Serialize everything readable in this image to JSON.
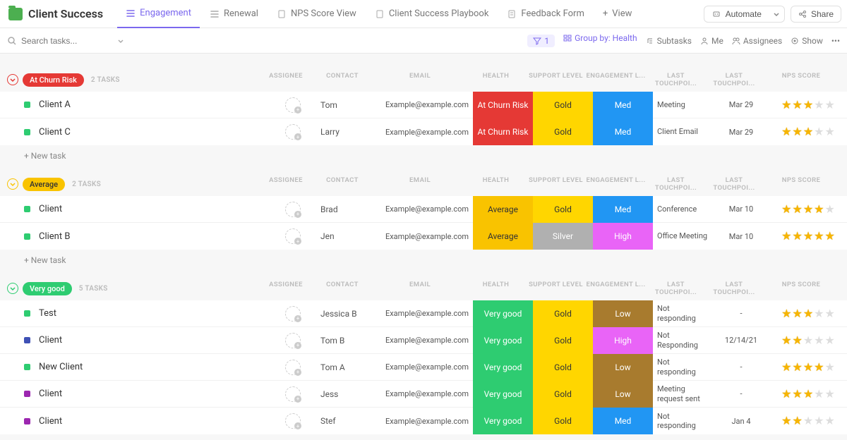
{
  "header": {
    "title": "Client Success",
    "tabs": [
      {
        "label": "Engagement",
        "icon": "list"
      },
      {
        "label": "Renewal",
        "icon": "list"
      },
      {
        "label": "NPS Score View",
        "icon": "doc"
      },
      {
        "label": "Client Success Playbook",
        "icon": "doc"
      },
      {
        "label": "Feedback Form",
        "icon": "form"
      }
    ],
    "add_view": "View",
    "automate": "Automate",
    "share": "Share"
  },
  "toolbar": {
    "search_placeholder": "Search tasks...",
    "filter_count": "1",
    "group_by": "Group by: Health",
    "subtasks": "Subtasks",
    "me": "Me",
    "assignees": "Assignees",
    "show": "Show"
  },
  "columns": {
    "assignee": "ASSIGNEE",
    "contact": "CONTACT",
    "email": "EMAIL",
    "health": "HEALTH",
    "support": "SUPPORT LEVEL",
    "engagement": "ENGAGEMENT L...",
    "touch_note": "LAST TOUCHPOI...",
    "touch_date": "LAST TOUCHPOI...",
    "nps": "NPS SCORE"
  },
  "new_task_label": "+ New task",
  "groups": [
    {
      "name": "At Churn Risk",
      "color": "red",
      "count": "2 TASKS",
      "rows": [
        {
          "dot": "#2ecc71",
          "name": "Client A",
          "contact": "Tom",
          "email": "Example@example.com",
          "health": "At Churn Risk",
          "health_c": "red",
          "support": "Gold",
          "support_c": "gold",
          "engage": "Med",
          "engage_c": "blue",
          "touch_note": "Meeting",
          "touch_date": "Mar 29",
          "nps": 3
        },
        {
          "dot": "#2ecc71",
          "name": "Client C",
          "contact": "Larry",
          "email": "Example@example.com",
          "health": "At Churn Risk",
          "health_c": "red",
          "support": "Gold",
          "support_c": "gold",
          "engage": "Med",
          "engage_c": "blue",
          "touch_note": "Client Email",
          "touch_date": "Mar 29",
          "nps": 3
        }
      ]
    },
    {
      "name": "Average",
      "color": "yellow",
      "count": "2 TASKS",
      "rows": [
        {
          "dot": "#2ecc71",
          "name": "Client",
          "contact": "Brad",
          "email": "Example@example.com",
          "health": "Average",
          "health_c": "yellow",
          "support": "Gold",
          "support_c": "gold",
          "engage": "Med",
          "engage_c": "blue",
          "touch_note": "Conference",
          "touch_date": "Mar 10",
          "nps": 4
        },
        {
          "dot": "#2ecc71",
          "name": "Client B",
          "contact": "Jen",
          "email": "Example@example.com",
          "health": "Average",
          "health_c": "yellow",
          "support": "Silver",
          "support_c": "silver",
          "engage": "High",
          "engage_c": "pink",
          "touch_note": "Office Meeting",
          "touch_date": "Mar 10",
          "nps": 5
        }
      ]
    },
    {
      "name": "Very good",
      "color": "green",
      "count": "5 TASKS",
      "rows": [
        {
          "dot": "#2ecc71",
          "name": "Test",
          "contact": "Jessica B",
          "email": "Example@example.com",
          "health": "Very good",
          "health_c": "green",
          "support": "Gold",
          "support_c": "gold",
          "engage": "Low",
          "engage_c": "brown",
          "touch_note": "Not responding",
          "touch_date": "-",
          "nps": 3
        },
        {
          "dot": "#3f51b5",
          "name": "Client",
          "contact": "Tom B",
          "email": "Example@example.com",
          "health": "Very good",
          "health_c": "green",
          "support": "Gold",
          "support_c": "gold",
          "engage": "High",
          "engage_c": "pink",
          "touch_note": "Not Responding",
          "touch_date": "12/14/21",
          "nps": 2
        },
        {
          "dot": "#2ecc71",
          "name": "New Client",
          "contact": "Tom A",
          "email": "Example@example.com",
          "health": "Very good",
          "health_c": "green",
          "support": "Gold",
          "support_c": "gold",
          "engage": "Low",
          "engage_c": "brown",
          "touch_note": "Not responding",
          "touch_date": "-",
          "nps": 4
        },
        {
          "dot": "#9c27b0",
          "name": "Client",
          "contact": "Jess",
          "email": "Example@example.com",
          "health": "Very good",
          "health_c": "green",
          "support": "Gold",
          "support_c": "gold",
          "engage": "Low",
          "engage_c": "brown",
          "touch_note": "Meeting request sent",
          "touch_date": "-",
          "nps": 3
        },
        {
          "dot": "#9c27b0",
          "name": "Client",
          "contact": "Stef",
          "email": "Example@example.com",
          "health": "Very good",
          "health_c": "green",
          "support": "Gold",
          "support_c": "gold",
          "engage": "Med",
          "engage_c": "blue",
          "touch_note": "Not responding",
          "touch_date": "Jan 4",
          "nps": 2
        }
      ]
    }
  ]
}
